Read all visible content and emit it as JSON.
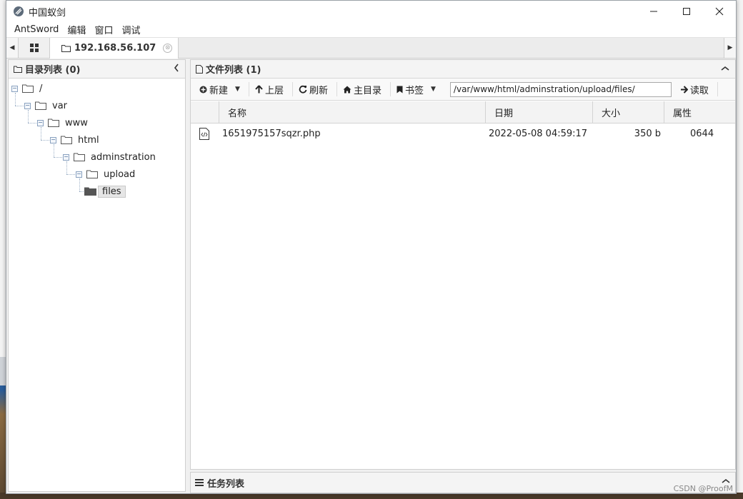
{
  "window": {
    "title": "中国蚁剑"
  },
  "menu": {
    "items": [
      "AntSword",
      "编辑",
      "窗口",
      "调试"
    ]
  },
  "tabs": {
    "active_label": "192.168.56.107",
    "close_glyph": "⊗"
  },
  "dir_panel": {
    "title": "目录列表 (0)",
    "tree": [
      {
        "label": "/",
        "level": 0
      },
      {
        "label": "var",
        "level": 1
      },
      {
        "label": "www",
        "level": 2
      },
      {
        "label": "html",
        "level": 3
      },
      {
        "label": "adminstration",
        "level": 4
      },
      {
        "label": "upload",
        "level": 5
      },
      {
        "label": "files",
        "level": 6,
        "selected": true
      }
    ]
  },
  "file_panel": {
    "title": "文件列表 (1)",
    "toolbar": {
      "new_label": "新建",
      "up_label": "上层",
      "refresh_label": "刷新",
      "home_label": "主目录",
      "bookmark_label": "书签",
      "path_value": "/var/www/html/adminstration/upload/files/",
      "read_label": "读取"
    },
    "columns": {
      "name": "名称",
      "date": "日期",
      "size": "大小",
      "attr": "属性"
    },
    "rows": [
      {
        "name": "1651975157sqzr.php",
        "date": "2022-05-08 04:59:17",
        "size": "350 b",
        "attr": "0644"
      }
    ]
  },
  "task_panel": {
    "title": "任务列表"
  },
  "watermark": "CSDN @ProofM",
  "colors": {
    "accent": "#4a6b96",
    "tree_line": "#9fb2c8"
  }
}
